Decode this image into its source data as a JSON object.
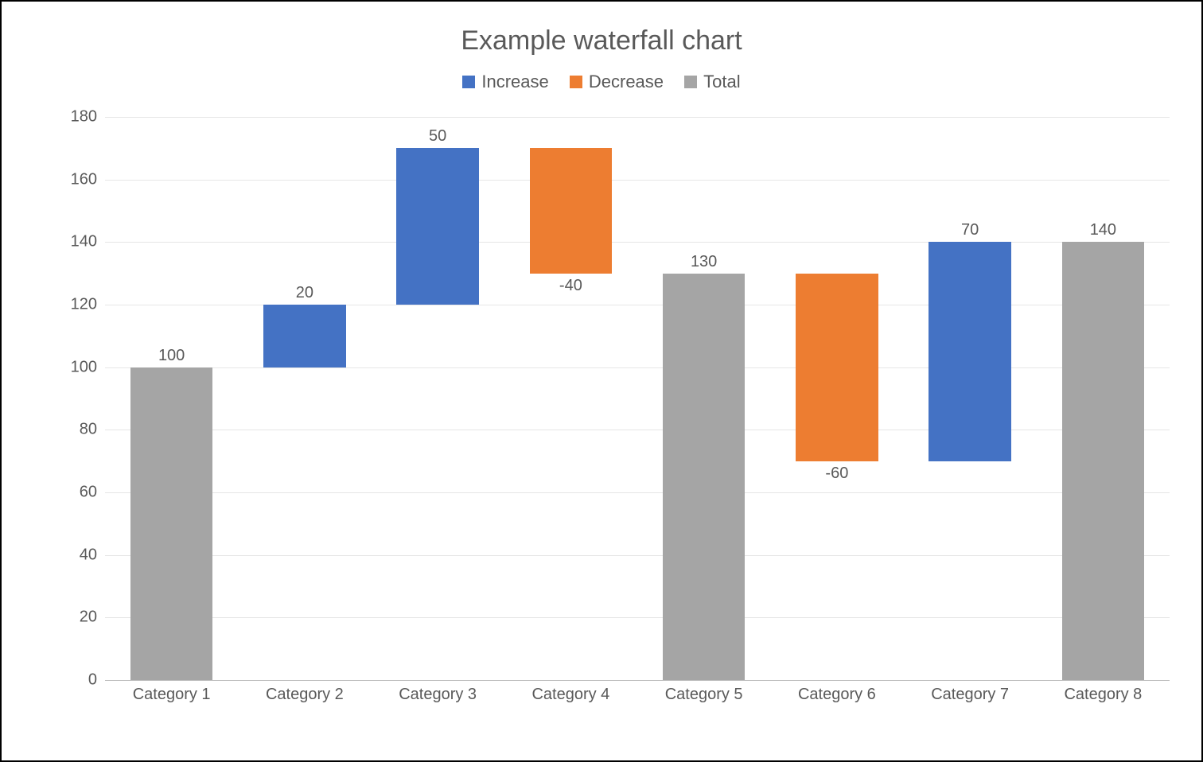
{
  "chart_data": {
    "type": "waterfall",
    "title": "Example waterfall chart",
    "legend": [
      {
        "name": "Increase",
        "color": "#4472C4"
      },
      {
        "name": "Decrease",
        "color": "#ED7D31"
      },
      {
        "name": "Total",
        "color": "#A5A5A5"
      }
    ],
    "ylim": [
      0,
      180
    ],
    "yticks": [
      0,
      20,
      40,
      60,
      80,
      100,
      120,
      140,
      160,
      180
    ],
    "xlabel": "",
    "ylabel": "",
    "grid": true,
    "categories": [
      "Category 1",
      "Category 2",
      "Category 3",
      "Category 4",
      "Category 5",
      "Category 6",
      "Category 7",
      "Category 8"
    ],
    "bars": [
      {
        "category": "Category 1",
        "type": "total",
        "label": "100",
        "value": 100,
        "base": 0,
        "top": 100
      },
      {
        "category": "Category 2",
        "type": "increase",
        "label": "20",
        "value": 20,
        "base": 100,
        "top": 120
      },
      {
        "category": "Category 3",
        "type": "increase",
        "label": "50",
        "value": 50,
        "base": 120,
        "top": 170
      },
      {
        "category": "Category 4",
        "type": "decrease",
        "label": "-40",
        "value": -40,
        "base": 170,
        "top": 130
      },
      {
        "category": "Category 5",
        "type": "total",
        "label": "130",
        "value": 130,
        "base": 0,
        "top": 130
      },
      {
        "category": "Category 6",
        "type": "decrease",
        "label": "-60",
        "value": -60,
        "base": 130,
        "top": 70
      },
      {
        "category": "Category 7",
        "type": "increase",
        "label": "70",
        "value": 70,
        "base": 70,
        "top": 140
      },
      {
        "category": "Category 8",
        "type": "total",
        "label": "140",
        "value": 140,
        "base": 0,
        "top": 140
      }
    ]
  }
}
